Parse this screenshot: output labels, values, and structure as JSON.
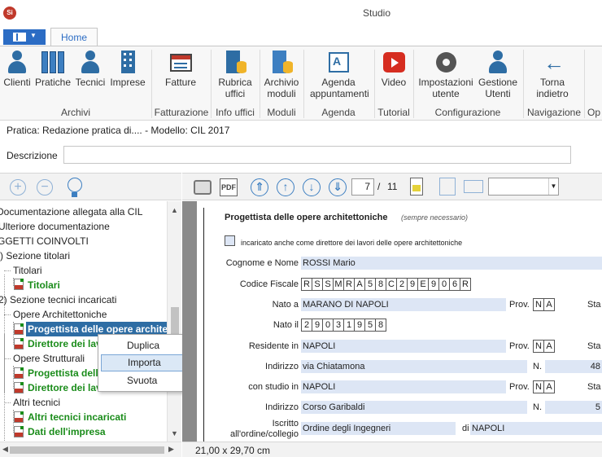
{
  "window": {
    "title": "Studio",
    "app_icon": "Si"
  },
  "ribbon": {
    "tab": "Home",
    "groups": [
      {
        "label": "Archivi",
        "buttons": [
          "Clienti",
          "Pratiche",
          "Tecnici",
          "Imprese"
        ]
      },
      {
        "label": "Fatturazione",
        "buttons": [
          "Fatture"
        ]
      },
      {
        "label": "Info uffici",
        "buttons": [
          "Rubrica uffici"
        ]
      },
      {
        "label": "Moduli",
        "buttons": [
          "Archivio moduli"
        ]
      },
      {
        "label": "Agenda",
        "buttons": [
          "Agenda appuntamenti"
        ]
      },
      {
        "label": "Tutorial",
        "buttons": [
          "Video"
        ]
      },
      {
        "label": "Configurazione",
        "buttons": [
          "Impostazioni utente",
          "Gestione Utenti"
        ]
      },
      {
        "label": "Navigazione",
        "buttons": [
          "Torna indietro"
        ]
      },
      {
        "label": "Op"
      }
    ]
  },
  "pratica": {
    "text": "Pratica: Redazione pratica di.... - Modello: CIL 2017"
  },
  "descrizione": {
    "label": "Descrizione",
    "value": ""
  },
  "tree": {
    "nodes": [
      "Documentazione allegata alla CIL",
      "Ulteriore documentazione",
      "GGETTI COINVOLTI",
      ") Sezione titolari",
      "Titolari",
      "Titolari",
      "2) Sezione tecnici incaricati",
      "Opere Architettoniche",
      "Progettista delle opere archite",
      "Direttore dei lav",
      "Opere Strutturali",
      "Progettista dell",
      "Direttore dei lav",
      "Altri tecnici",
      "Altri tecnici incaricati",
      "Dati dell'impresa"
    ]
  },
  "context_menu": {
    "items": [
      "Duplica",
      "Importa",
      "Svuota"
    ],
    "highlighted": "Importa"
  },
  "pager": {
    "current": "7",
    "separator": "/",
    "total": "11"
  },
  "status": {
    "page_size": "21,00 x 29,70 cm"
  },
  "form": {
    "section_title": "Progettista delle opere architettoniche",
    "section_note": "(sempre necessario)",
    "checkbox_label": "incaricato anche come direttore dei lavori delle opere architettoniche",
    "cognome_label": "Cognome e Nome",
    "cognome_value": "ROSSI Mario",
    "cf_label": "Codice Fiscale",
    "cf_chars": [
      "R",
      "S",
      "S",
      "M",
      "R",
      "A",
      "5",
      "8",
      "C",
      "2",
      "9",
      "E",
      "9",
      "0",
      "6",
      "R"
    ],
    "nato_a_label": "Nato a",
    "nato_a_value": "MARANO DI NAPOLI",
    "prov_label": "Prov.",
    "prov_nato": [
      "N",
      "A"
    ],
    "stato_label": "Sta",
    "nato_il_label": "Nato il",
    "nato_il_chars": [
      "2",
      "9",
      "0",
      "3",
      "1",
      "9",
      "5",
      "8"
    ],
    "residente_label": "Residente in",
    "residente_value": "NAPOLI",
    "prov_res": [
      "N",
      "A"
    ],
    "indirizzo_label": "Indirizzo",
    "indirizzo_value": "via Chiatamona",
    "n_label": "N.",
    "n_value": "48",
    "studio_label": "con studio in",
    "studio_value": "NAPOLI",
    "prov_studio": [
      "N",
      "A"
    ],
    "indirizzo2_value": "Corso Garibaldi",
    "n2_value": "5",
    "iscritto_label_1": "Iscritto",
    "iscritto_label_2": "all'ordine/collegio",
    "ordine_value": "Ordine degli Ingegneri",
    "di_label": "di",
    "di_value": "NAPOLI"
  }
}
